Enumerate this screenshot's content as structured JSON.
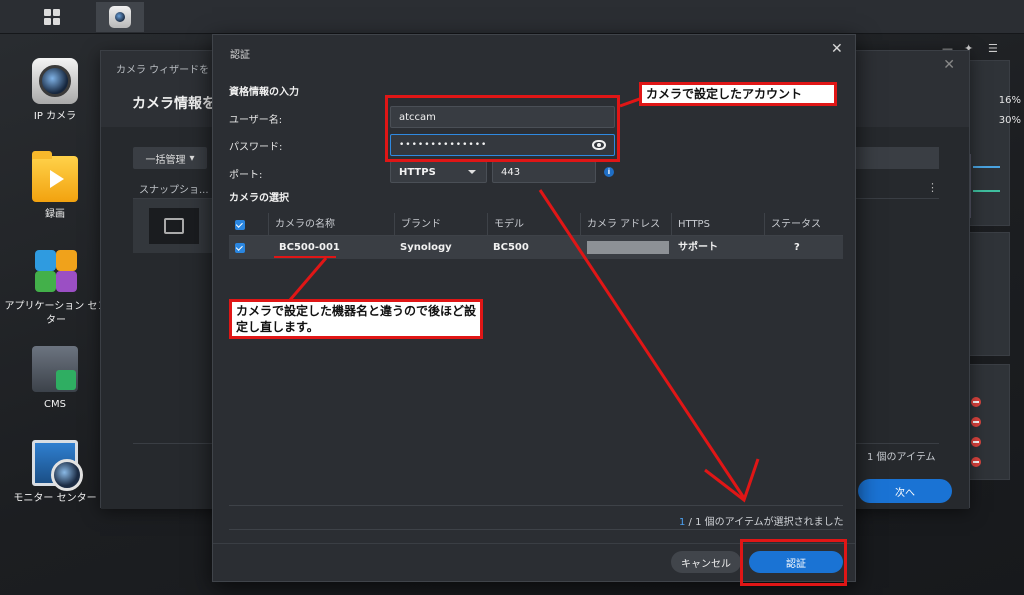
{
  "taskbar": {
    "main_menu_icon": "grid-icon",
    "active_app_icon": "surveillance-camera-icon"
  },
  "desktop": {
    "icons": [
      {
        "label": "IP カメラ",
        "icon": "ip-camera-icon"
      },
      {
        "label": "録画",
        "icon": "recording-folder-icon"
      },
      {
        "label": "アプリケーション センター",
        "icon": "puzzle-icon"
      },
      {
        "label": "CMS",
        "icon": "cms-icon"
      },
      {
        "label": "モニター センター",
        "icon": "monitor-center-icon"
      }
    ]
  },
  "wizard": {
    "title": "カメラ ウィザードを",
    "heading": "カメラ情報を",
    "bulk_button": "一括管理",
    "column_snapshot": "スナップショ...",
    "item_count": "1 個のアイテム",
    "next_button": "次へ"
  },
  "widgets": {
    "pct1": "16%",
    "pct2": "30%"
  },
  "dialog": {
    "title": "認証",
    "credentials_section": "資格情報の入力",
    "username_label": "ユーザー名:",
    "username_value": "atccam",
    "password_label": "パスワード:",
    "password_masked": "••••••••••••••",
    "port_label": "ポート:",
    "protocol_value": "HTTPS",
    "port_value": "443",
    "camera_section": "カメラの選択",
    "table": {
      "headers": [
        "カメラの名称",
        "ブランド",
        "モデル",
        "カメラ アドレス",
        "HTTPS",
        "ステータス"
      ],
      "rows": [
        {
          "name": "BC500-001",
          "brand": "Synology",
          "model": "BC500",
          "address": "",
          "https": "サポート",
          "status": "?"
        }
      ]
    },
    "selection_current": "1",
    "selection_text": " / 1 個のアイテムが選択されました",
    "cancel_button": "キャンセル",
    "auth_button": "認証"
  },
  "annotations": {
    "account_note": "カメラで設定したアカウント",
    "name_note": "カメラで設定した機器名と違うので後ほど設定し直します。"
  },
  "colors": {
    "accent": "#1a73d4",
    "annotation_red": "#e01616",
    "dialog_bg": "#2b2e33"
  }
}
